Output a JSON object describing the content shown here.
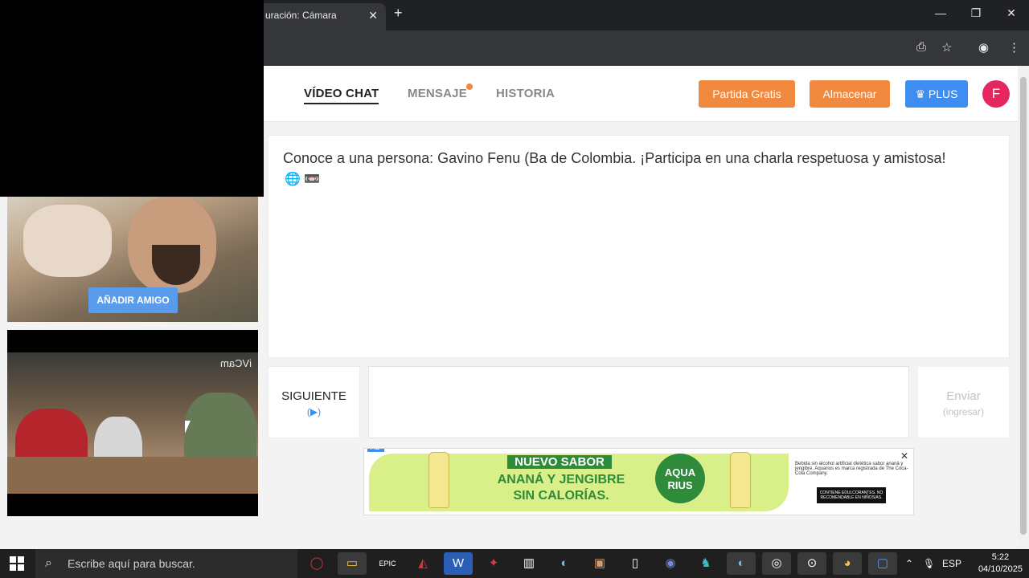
{
  "browser": {
    "tab_title": "uración: Cámara",
    "tab_close": "✕",
    "new_tab": "+",
    "minimize": "—",
    "maximize": "❐",
    "close": "✕"
  },
  "nav": {
    "video_chat": "VÍDEO CHAT",
    "messages": "MENSAJE",
    "history": "HISTORIA",
    "free_game": "Partida Gratis",
    "store": "Almacenar",
    "plus": "♛ PLUS",
    "avatar_letter": "F"
  },
  "video": {
    "add_friend": "AÑADIR AMIGO",
    "watermark": "iVCam"
  },
  "chat": {
    "intro": "Conoce a una persona: Gavino Fenu (Ba de Colombia. ¡Participa en una charla respetuosa y amistosa!",
    "flags": "🌐 📼"
  },
  "controls": {
    "next_label": "SIGUIENTE",
    "next_hint": "(▶)",
    "send_label": "Enviar",
    "send_hint": "(ingresar)",
    "message_placeholder": ""
  },
  "ad": {
    "tag": "AD",
    "line1": "NUEVO SABOR",
    "line2": "ANANÁ Y JENGIBRE",
    "line3": "SIN CALORÍAS.",
    "brand": "AQUA RIUS",
    "legal": "Bebida sin alcohol artificial dietética sabor ananá y jengibre. Aquarius es marca registrada de The Coca-Cola Company.",
    "badge": "CONTIENE EDULCORANTES. NO RECOMENDABLE EN NIÑOS/AS.",
    "close": "✕"
  },
  "taskbar": {
    "search_placeholder": "Escribe aquí para buscar.",
    "language": "ESP",
    "time": "5:22",
    "date": "04/10/2025"
  },
  "colors": {
    "accent_orange": "#f0883e",
    "accent_blue": "#3d8ef0",
    "avatar_pink": "#e6265e"
  }
}
